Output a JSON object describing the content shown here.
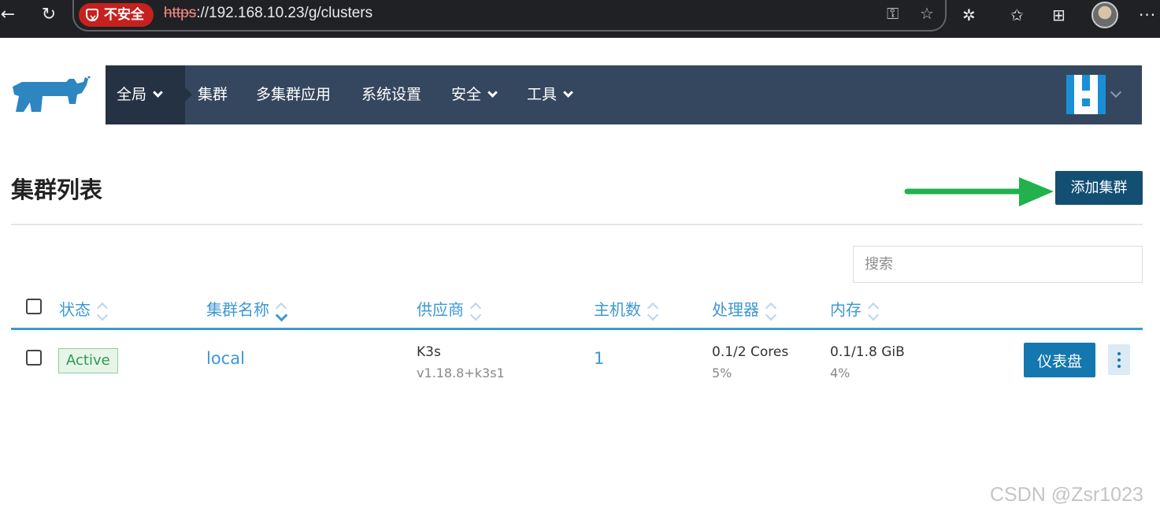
{
  "browser": {
    "security_label": "不安全",
    "url_scheme": "https",
    "url_rest": "://192.168.10.23/g/clusters",
    "icons": [
      "back-icon",
      "reload-icon",
      "key-icon",
      "star-icon",
      "extensions-icon",
      "favorites-icon",
      "collections-icon",
      "profile-avatar",
      "more-icon"
    ]
  },
  "nav": {
    "global": "全局",
    "clusters": "集群",
    "multi_cluster_apps": "多集群应用",
    "settings": "系统设置",
    "security": "安全",
    "tools": "工具"
  },
  "page": {
    "title": "集群列表",
    "add_button": "添加集群",
    "search_placeholder": "搜索"
  },
  "table": {
    "columns": {
      "state": "状态",
      "name": "集群名称",
      "provider": "供应商",
      "nodes": "主机数",
      "cpu": "处理器",
      "memory": "内存"
    },
    "rows": [
      {
        "state": "Active",
        "name": "local",
        "provider": "K3s",
        "version": "v1.18.8+k3s1",
        "nodes": "1",
        "cpu": "0.1/2 Cores",
        "cpu_pct": "5%",
        "memory": "0.1/1.8 GiB",
        "memory_pct": "4%",
        "dashboard_button": "仪表盘"
      }
    ]
  },
  "colors": {
    "nav_bg": "#35475e",
    "nav_active": "#253243",
    "primary": "#1477b0",
    "add_button": "#124f73",
    "link": "#3d98d3",
    "active_green": "#2e9a47",
    "arrow_green": "#22b14c"
  },
  "watermark": "CSDN @Zsr1023"
}
